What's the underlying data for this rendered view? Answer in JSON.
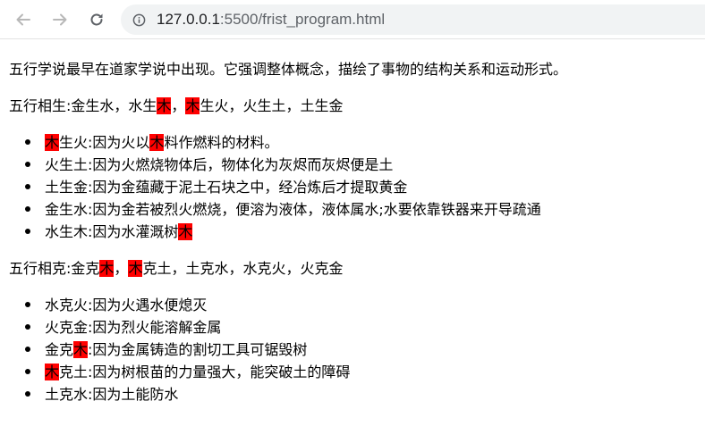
{
  "browser": {
    "url_host": "127.0.0.1",
    "url_rest": ":5500/frist_program.html",
    "colors": {
      "highlight": "#ff0000",
      "omnibox_bg": "#f1f3f4"
    },
    "icons": [
      "back-arrow-icon",
      "forward-arrow-icon",
      "reload-icon",
      "info-icon"
    ]
  },
  "page": {
    "intro": "五行学说最早在道家学说中出现。它强调整体概念，描绘了事物的结构关系和运动形式。",
    "sheng": {
      "heading": [
        "五行相生:金生水，水生",
        "木",
        "，",
        "木",
        "生火，火生土，土生金"
      ],
      "items": [
        [
          "",
          "木",
          "生火:因为火以",
          "木",
          "料作燃料的材料。"
        ],
        [
          "火生土:因为火燃烧物体后，物体化为灰烬而灰烬便是土"
        ],
        [
          "土生金:因为金蕴藏于泥土石块之中，经冶炼后才提取黄金"
        ],
        [
          "金生水:因为金若被烈火燃烧，便溶为液体，液体属水;水要依靠铁器来开导疏通"
        ],
        [
          "水生木:因为水灌溉树",
          "木"
        ]
      ]
    },
    "ke": {
      "heading": [
        "五行相克:金克",
        "木",
        "，",
        "木",
        "克土，土克水，水克火，火克金"
      ],
      "items": [
        [
          "水克火:因为火遇水便熄灭"
        ],
        [
          "火克金:因为烈火能溶解金属"
        ],
        [
          "金克",
          "木",
          ":因为金属铸造的割切工具可锯毁树"
        ],
        [
          "",
          "木",
          "克土:因为树根苗的力量强大，能突破土的障碍"
        ],
        [
          "土克水:因为土能防水"
        ]
      ]
    }
  }
}
